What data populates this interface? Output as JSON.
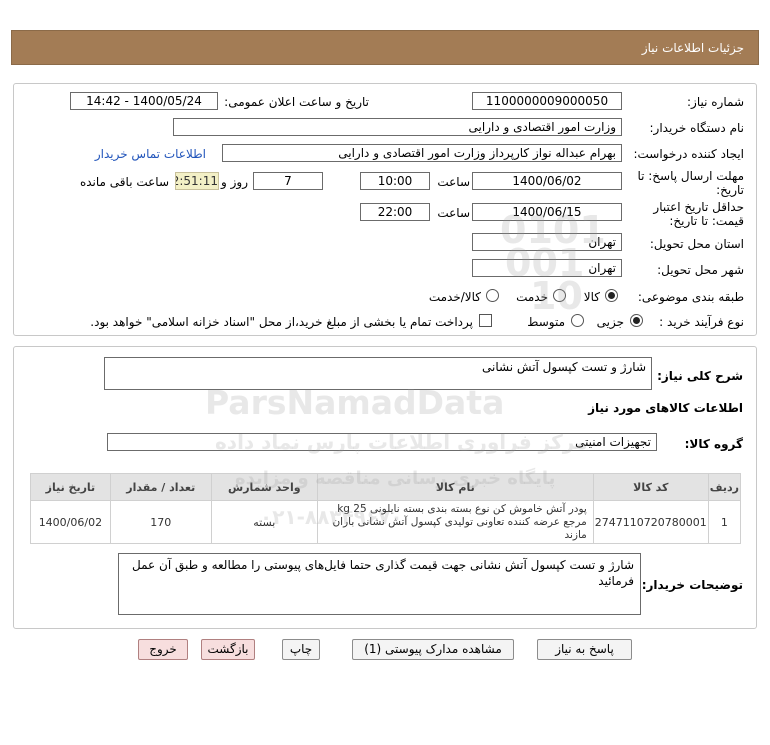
{
  "header": {
    "title": "جزئیات اطلاعات نیاز"
  },
  "form": {
    "need_number_label": "شماره نیاز:",
    "need_number": "1100000009000050",
    "announce_label": "تاریخ و ساعت اعلان عمومی:",
    "announce_value": "1400/05/24 - 14:42",
    "buyer_org_label": "نام دستگاه خریدار:",
    "buyer_org": "وزارت امور اقتصادی و دارایی",
    "requester_label": "ایجاد کننده درخواست:",
    "requester": "بهرام عبداله نواز کارپرداز وزارت امور اقتصادی و دارایی",
    "contact_link": "اطلاعات تماس خریدار",
    "reply_deadline_label_1": "مهلت ارسال پاسخ: تا",
    "reply_deadline_label_2": "تاریخ:",
    "reply_date": "1400/06/02",
    "time_label": "ساعت",
    "reply_time": "10:00",
    "days_count": "7",
    "days_label": "روز و",
    "remaining_time": "22:51:11",
    "remaining_label": "ساعت باقی مانده",
    "validity_label_1": "حداقل تاریخ اعتبار",
    "validity_label_2": "قیمت: تا تاریخ:",
    "validity_date": "1400/06/15",
    "validity_time": "22:00",
    "province_label": "استان محل تحویل:",
    "province": "تهران",
    "city_label": "شهر محل تحویل:",
    "city": "تهران",
    "category_label": "طبقه بندی موضوعی:",
    "category_options": [
      "کالا",
      "خدمت",
      "کالا/خدمت"
    ],
    "process_label": "نوع فرآیند خرید :",
    "process_options": [
      "جزیی",
      "متوسط"
    ],
    "payment_note": "پرداخت تمام یا بخشی از مبلغ خرید،از محل \"اسناد خزانه اسلامی\" خواهد بود."
  },
  "details": {
    "summary_label": "شرح کلی نیاز:",
    "summary": "شارژ و تست کپسول آتش نشانی",
    "goods_info_title": "اطلاعات کالاهای مورد نیاز",
    "group_label": "گروه کالا:",
    "group": "تجهیزات امنیتی",
    "table": {
      "headers": [
        "ردیف",
        "کد کالا",
        "نام کالا",
        "واحد شمارش",
        "تعداد / مقدار",
        "تاریخ نیاز"
      ],
      "rows": [
        [
          "1",
          "2747110720780001",
          "پودر آتش خاموش کن نوع بسته بندی بسته نایلونی kg 25 مرجع عرضه کننده تعاونی تولیدی کپسول آتش نشانی باران مازند",
          "بسته",
          "170",
          "1400/06/02"
        ]
      ]
    },
    "buyer_notes_label": "توضیحات خریدار:",
    "buyer_notes": "شارژ و تست کپسول آتش نشانی جهت قیمت گذاری حتما فایل‌های پیوستی را مطالعه و طبق آن عمل فرمائید"
  },
  "buttons": {
    "reply": "پاسخ به نیاز",
    "attachments": "مشاهده مدارک پیوستی (1)",
    "print": "چاپ",
    "back": "بازگشت",
    "exit": "خروج"
  },
  "watermark": {
    "logo_text": "ParsNamadData",
    "digits_1": "0101",
    "digits_2": "001",
    "digits_3": "10",
    "fa_line_1": "مرکز فراوری اطلاعات پارس نماد داده",
    "fa_line_2": "پایگاه خبری رسانی مناقصه و مزایده",
    "phone": "۰۲۱-۸۸۳۴۹۶۷۰"
  }
}
